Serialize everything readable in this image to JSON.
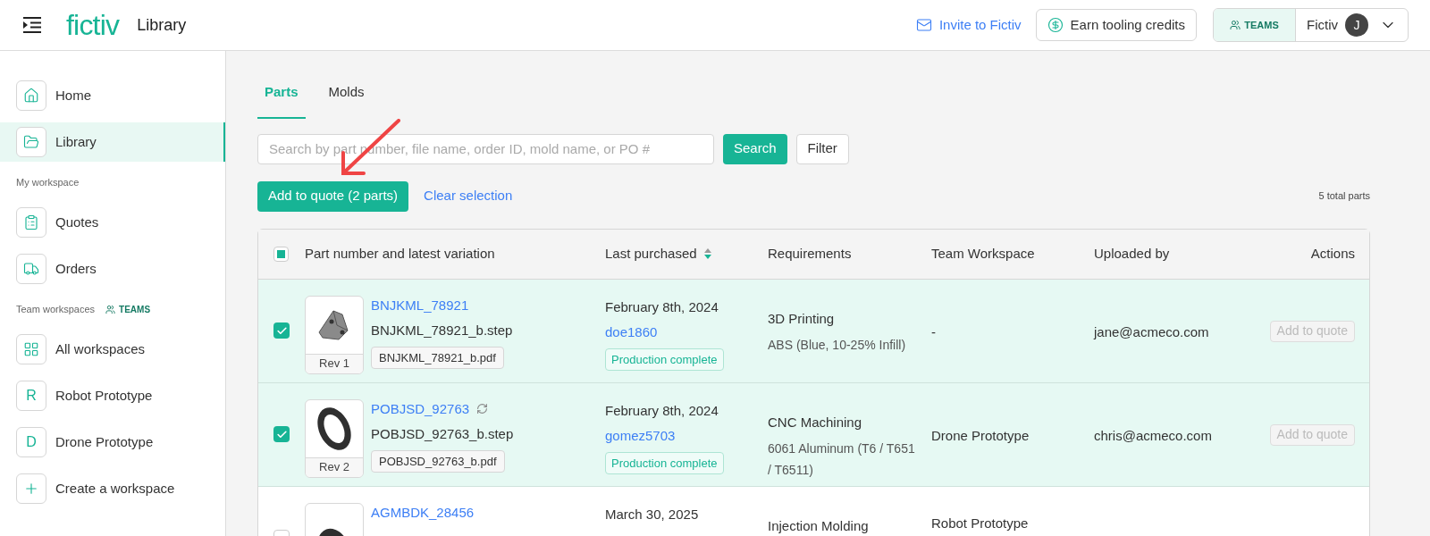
{
  "header": {
    "logo": "fictiv",
    "page_title": "Library",
    "invite_link": "Invite to Fictiv",
    "credits_button": "Earn tooling credits",
    "teams_badge": "TEAMS",
    "account_name": "Fictiv",
    "avatar_initial": "J"
  },
  "sidebar": {
    "items": [
      {
        "kind": "nav",
        "label": "Home",
        "selected": false
      },
      {
        "kind": "nav",
        "label": "Library",
        "selected": true
      },
      {
        "kind": "section",
        "label": "My workspace"
      },
      {
        "kind": "nav",
        "label": "Quotes",
        "selected": false
      },
      {
        "kind": "nav",
        "label": "Orders",
        "selected": false
      },
      {
        "kind": "section",
        "label": "Team workspaces",
        "badge": "TEAMS"
      },
      {
        "kind": "nav",
        "label": "All workspaces",
        "selected": false
      },
      {
        "kind": "nav",
        "letter": "R",
        "label": "Robot Prototype",
        "selected": false
      },
      {
        "kind": "nav",
        "letter": "D",
        "label": "Drone Prototype",
        "selected": false
      },
      {
        "kind": "nav",
        "label": "Create a workspace",
        "selected": false
      }
    ]
  },
  "tabs": [
    {
      "label": "Parts",
      "selected": true
    },
    {
      "label": "Molds",
      "selected": false
    }
  ],
  "search": {
    "placeholder": "Search by part number, file name, order ID, mold name, or PO #",
    "button": "Search",
    "filter_button": "Filter"
  },
  "selection_bar": {
    "add_button": "Add to quote (2 parts)",
    "clear_link": "Clear selection",
    "total": "5 total parts"
  },
  "table": {
    "select_all": {
      "partial": true
    },
    "columns": [
      {
        "label": "Part number and latest variation",
        "sortable": false
      },
      {
        "label": "Last purchased",
        "sortable": true
      },
      {
        "label": "Requirements",
        "sortable": false
      },
      {
        "label": "Team Workspace",
        "sortable": false
      },
      {
        "label": "Uploaded by",
        "sortable": false
      },
      {
        "label": "Actions",
        "sortable": false
      }
    ],
    "rows": [
      {
        "selected": true,
        "rev": "Rev 1",
        "part_number": "BNJKML_78921",
        "synced": false,
        "file": "BNJKML_78921_b.step",
        "drawing": "BNJKML_78921_b.pdf",
        "date": "February 8th, 2024",
        "buyer": "doe1860",
        "status": "Production complete",
        "process": "3D Printing",
        "material": "ABS (Blue, 10-25% Infill)",
        "workspace": "-",
        "uploaded_by": "jane@acmeco.com",
        "action": "Add to quote",
        "action_disabled": true
      },
      {
        "selected": true,
        "rev": "Rev 2",
        "part_number": "POBJSD_92763",
        "synced": true,
        "file": "POBJSD_92763_b.step",
        "drawing": "POBJSD_92763_b.pdf",
        "date": "February 8th, 2024",
        "buyer": "gomez5703",
        "status": "Production complete",
        "process": "CNC Machining",
        "material": "6061 Aluminum (T6 / T651 / T6511)",
        "workspace": "Drone Prototype",
        "uploaded_by": "chris@acmeco.com",
        "action": "Add to quote",
        "action_disabled": true
      },
      {
        "selected": false,
        "part_number": "AGMBDK_28456",
        "synced": false,
        "date": "March 30, 2025",
        "process": "Injection Molding",
        "workspace": "Robot Prototype"
      }
    ]
  }
}
